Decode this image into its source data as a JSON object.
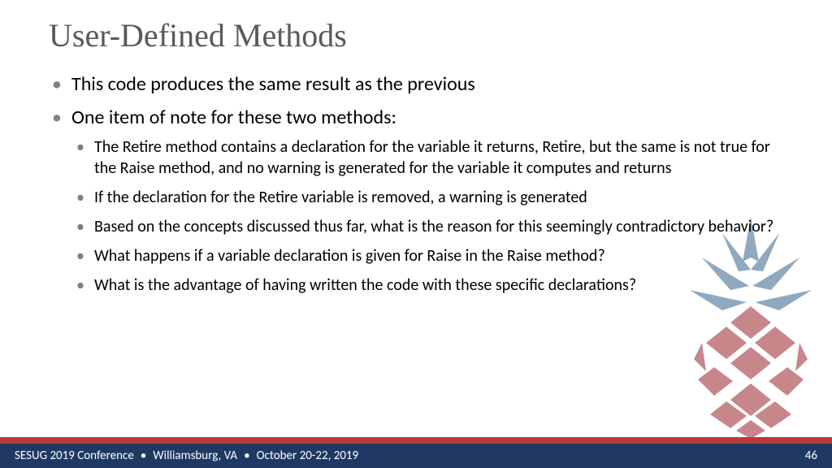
{
  "title": "User-Defined Methods",
  "bullets": {
    "l1": [
      "This code produces the same result as the previous",
      "One item of note for these two methods:"
    ],
    "l2": [
      "The Retire method contains a declaration for the variable it returns, Retire, but the same is not true for the Raise method, and no warning is generated for the variable it computes and returns",
      "If the declaration for the Retire variable is removed, a warning is generated",
      "Based on the concepts discussed thus far, what is the reason for this seemingly contradictory behavior?",
      "What happens if a variable declaration is given for Raise in the Raise method?",
      "What is the advantage of having written the code with these specific declarations?"
    ]
  },
  "footer": {
    "conference": "SESUG 2019 Conference",
    "location": "Williamsburg, VA",
    "dates": "October 20-22, 2019",
    "page": "46"
  }
}
